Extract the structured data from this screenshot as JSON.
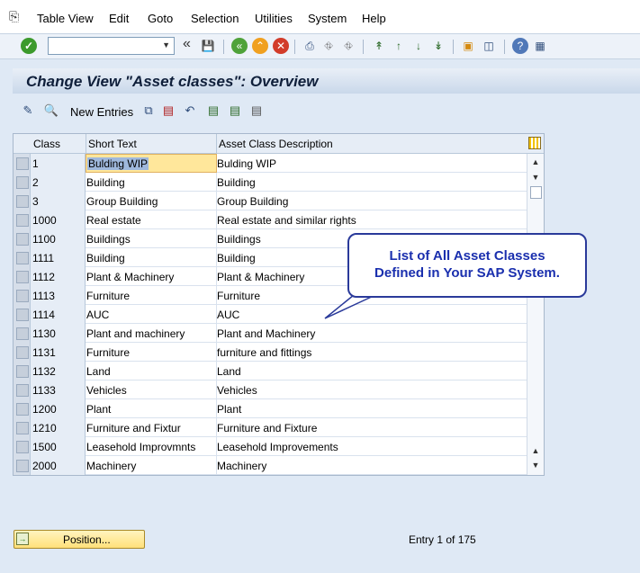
{
  "menubar": {
    "items": [
      "Table View",
      "Edit",
      "Goto",
      "Selection",
      "Utilities",
      "System",
      "Help"
    ]
  },
  "toolbar": {
    "command_field_value": ""
  },
  "title": "Change View \"Asset classes\": Overview",
  "app_toolbar": {
    "new_entries_label": "New Entries"
  },
  "table": {
    "columns": [
      "Class",
      "Short Text",
      "Asset Class Description"
    ],
    "rows": [
      {
        "class": "1",
        "short": "Bulding WIP",
        "desc": "Bulding WIP"
      },
      {
        "class": "2",
        "short": "Building",
        "desc": "Building"
      },
      {
        "class": "3",
        "short": "Group Building",
        "desc": "Group Building"
      },
      {
        "class": "1000",
        "short": "Real estate",
        "desc": "Real estate and similar rights"
      },
      {
        "class": "1100",
        "short": "Buildings",
        "desc": "Buildings"
      },
      {
        "class": "1111",
        "short": "Building",
        "desc": "Building"
      },
      {
        "class": "1112",
        "short": "Plant & Machinery",
        "desc": "Plant & Machinery"
      },
      {
        "class": "1113",
        "short": "Furniture",
        "desc": "Furniture"
      },
      {
        "class": "1114",
        "short": "AUC",
        "desc": "AUC"
      },
      {
        "class": "1130",
        "short": "Plant and machinery",
        "desc": "Plant and Machinery"
      },
      {
        "class": "1131",
        "short": "Furniture",
        "desc": "furniture and fittings"
      },
      {
        "class": "1132",
        "short": "Land",
        "desc": "Land"
      },
      {
        "class": "1133",
        "short": "Vehicles",
        "desc": "Vehicles"
      },
      {
        "class": "1200",
        "short": "Plant",
        "desc": "Plant"
      },
      {
        "class": "1210",
        "short": "Furniture and Fixtur",
        "desc": "Furniture and Fixture"
      },
      {
        "class": "1500",
        "short": "Leasehold Improvmnts",
        "desc": "Leasehold Improvements"
      },
      {
        "class": "2000",
        "short": "Machinery",
        "desc": "Machinery"
      }
    ]
  },
  "callout": {
    "line1": "List of All Asset Classes",
    "line2": "Defined in Your SAP System."
  },
  "footer": {
    "position_label": "Position...",
    "entry_info": "Entry 1 of 175"
  },
  "colors": {
    "title_bg": "#c9d8ea",
    "focus_cell": "#ffe79b",
    "callout_text": "#1a2fae",
    "position_button": "#ffe07a"
  }
}
